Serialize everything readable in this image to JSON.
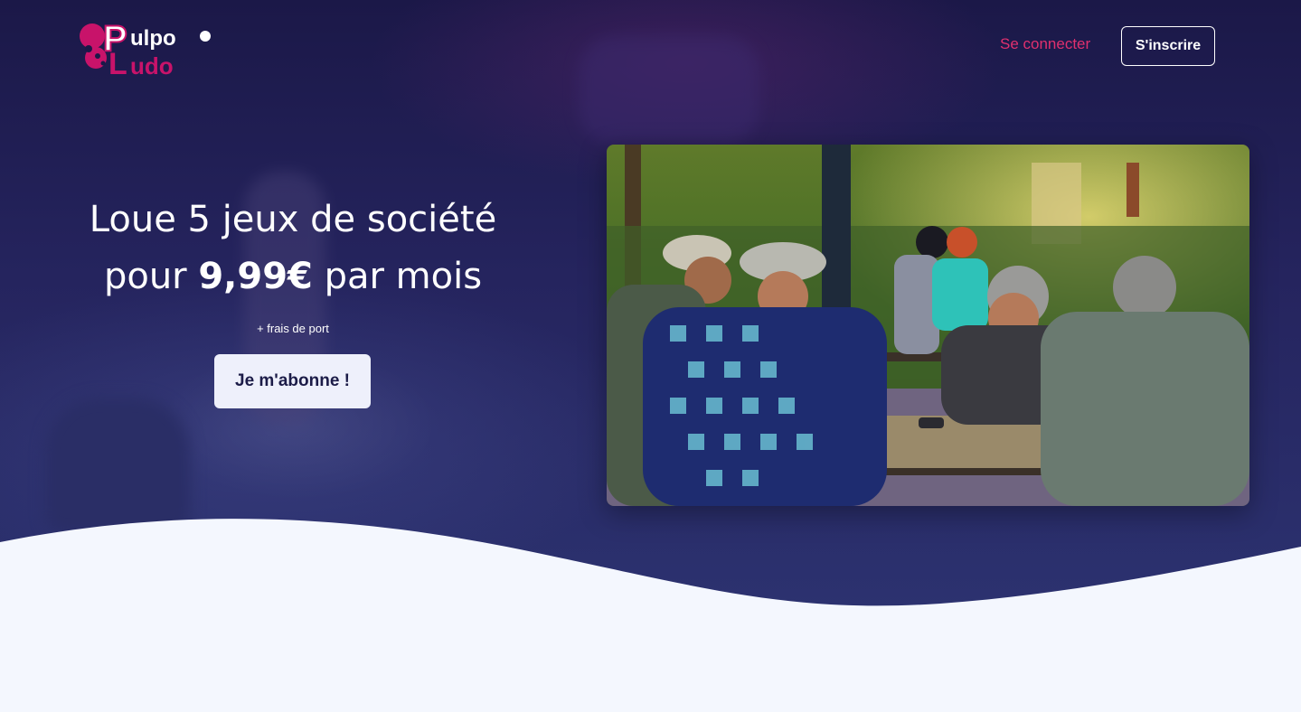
{
  "brand": {
    "logo_top": "ulpo",
    "logo_bottom": "udo",
    "logo_initial_top": "P",
    "logo_initial_bottom": "L"
  },
  "nav": {
    "login_label": "Se connecter",
    "signup_label": "S'inscrire"
  },
  "hero": {
    "headline_line1": "Loue 5 jeux de société",
    "headline_pre": "pour ",
    "headline_price": "9,99€",
    "headline_post": " par mois",
    "shipping_note": "+ frais de port",
    "cta_label": "Je m'abonne !"
  },
  "colors": {
    "accent": "#e0306e",
    "logo_magenta": "#c8136a",
    "hero_bg": "#25245e",
    "page_bg": "#f4f7fe"
  }
}
